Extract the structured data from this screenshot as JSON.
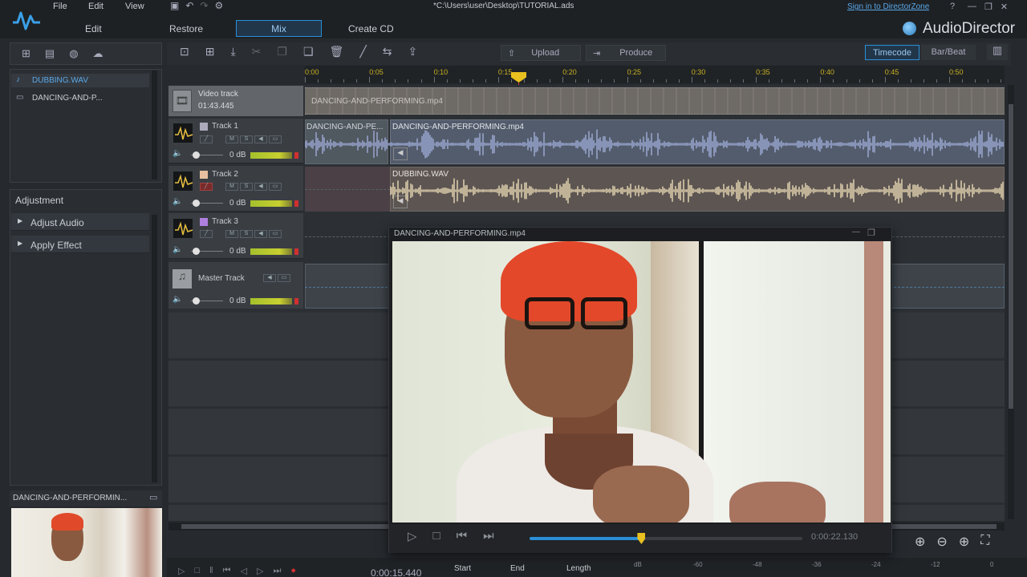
{
  "window": {
    "title": "*C:\\Users\\user\\Desktop\\TUTORIAL.ads",
    "menu": [
      "File",
      "Edit",
      "View"
    ],
    "sign_in": "Sign in to DirectorZone",
    "help": "?",
    "brand": "AudioDirector"
  },
  "modes": [
    "Edit",
    "Restore",
    "Mix",
    "Create CD"
  ],
  "active_mode": "Mix",
  "toolbar": {
    "upload_label": "Upload",
    "produce_label": "Produce",
    "timecode_label": "Timecode",
    "barbeat_label": "Bar/Beat"
  },
  "library": {
    "items": [
      "DUBBING.WAV",
      "DANCING-AND-P..."
    ]
  },
  "adjustment": {
    "title": "Adjustment",
    "items": [
      "Adjust Audio",
      "Apply Effect"
    ]
  },
  "preview_thumb": {
    "title": "DANCING-AND-PERFORMIN..."
  },
  "ruler": {
    "ticks": [
      "0:00",
      "0:05",
      "0:10",
      "0:15",
      "0:20",
      "0:25",
      "0:30",
      "0:35",
      "0:40",
      "0:45",
      "0:50"
    ]
  },
  "tracks": {
    "video": {
      "name": "Video track",
      "duration": "01:43.445",
      "clip": "DANCING-AND-PERFORMING.mp4"
    },
    "track1": {
      "name": "Track 1",
      "db": "0 dB",
      "clip_a": "DANCING-AND-PE...",
      "clip_b": "DANCING-AND-PERFORMING.mp4"
    },
    "track2": {
      "name": "Track 2",
      "db": "0 dB",
      "clip": "DUBBING.WAV"
    },
    "track3": {
      "name": "Track 3",
      "db": "0 dB"
    },
    "master": {
      "name": "Master Track",
      "db": "0 dB"
    },
    "mini_btn_labels": [
      "M",
      "S"
    ]
  },
  "video_popup": {
    "title": "DANCING-AND-PERFORMING.mp4",
    "time": "0:00:22.130",
    "progress": 0.41
  },
  "bottom": {
    "timecode": "0:00:15.440",
    "start_label": "Start",
    "end_label": "End",
    "length_label": "Length",
    "db_scale": [
      "dB",
      "-60",
      "-48",
      "-36",
      "-24",
      "-12",
      "0"
    ]
  },
  "colors": {
    "accent": "#2a8fd6",
    "waveform_blue": "#9aa6d0",
    "waveform_gold": "#e0d2ae",
    "playhead": "#e04040",
    "timeline_tick": "#c8b020"
  }
}
